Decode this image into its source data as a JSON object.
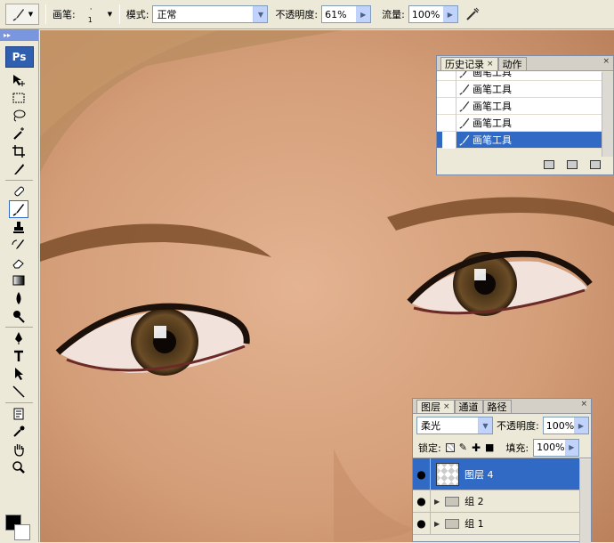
{
  "options_bar": {
    "brush_label": "画笔:",
    "brush_size": "1",
    "mode_label": "模式:",
    "mode_value": "正常",
    "opacity_label": "不透明度:",
    "opacity_value": "61%",
    "flow_label": "流量:",
    "flow_value": "100%"
  },
  "toolbox": {
    "logo": "Ps",
    "tools": [
      "move-icon",
      "marquee-icon",
      "lasso-icon",
      "magic-wand-icon",
      "crop-icon",
      "slice-icon",
      "healing-brush-icon",
      "brush-icon",
      "clone-stamp-icon",
      "history-brush-icon",
      "eraser-icon",
      "gradient-icon",
      "blur-icon",
      "dodge-icon",
      "pen-icon",
      "type-icon",
      "path-select-icon",
      "line-icon",
      "notes-icon",
      "eyedropper-icon",
      "hand-icon",
      "zoom-icon"
    ],
    "selected_tool": "brush-icon"
  },
  "history_panel": {
    "tabs": [
      {
        "label": "历史记录",
        "active": true
      },
      {
        "label": "动作",
        "active": false
      }
    ],
    "rows": [
      {
        "label": "画笔工具",
        "selected": false
      },
      {
        "label": "画笔工具",
        "selected": false
      },
      {
        "label": "画笔工具",
        "selected": false
      },
      {
        "label": "画笔工具",
        "selected": false
      },
      {
        "label": "画笔工具",
        "selected": true
      }
    ]
  },
  "layers_panel": {
    "tabs": [
      {
        "label": "图层",
        "active": true
      },
      {
        "label": "通道",
        "active": false
      },
      {
        "label": "路径",
        "active": false
      }
    ],
    "blend_mode": "柔光",
    "opacity_label": "不透明度:",
    "opacity_value": "100%",
    "lock_label": "锁定:",
    "fill_label": "填充:",
    "fill_value": "100%",
    "layers": [
      {
        "name": "图层 4",
        "type": "layer",
        "selected": true
      },
      {
        "name": "组 2",
        "type": "group",
        "selected": false
      },
      {
        "name": "组 1",
        "type": "group",
        "selected": false
      }
    ]
  },
  "colors": {
    "accent": "#316ac5",
    "chrome": "#ece9d8"
  }
}
